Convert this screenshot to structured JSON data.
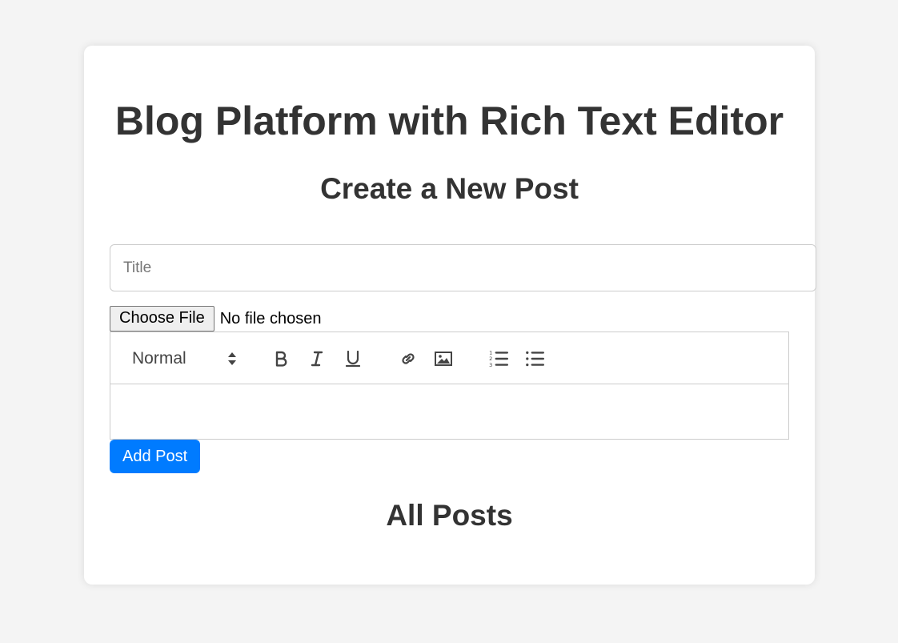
{
  "page": {
    "title": "Blog Platform with Rich Text Editor"
  },
  "create_section": {
    "heading": "Create a New Post"
  },
  "form": {
    "title_placeholder": "Title",
    "title_value": "",
    "file_button_label": "Choose File",
    "file_status": "No file chosen",
    "submit_label": "Add Post"
  },
  "editor": {
    "format_value": "Normal",
    "toolbar_icons": [
      "bold-icon",
      "italic-icon",
      "underline-icon",
      "link-icon",
      "image-icon",
      "ordered-list-icon",
      "bullet-list-icon"
    ],
    "content": ""
  },
  "posts_section": {
    "heading": "All Posts"
  },
  "colors": {
    "background": "#f4f4f4",
    "card": "#ffffff",
    "text": "#333333",
    "accent": "#007bff"
  }
}
